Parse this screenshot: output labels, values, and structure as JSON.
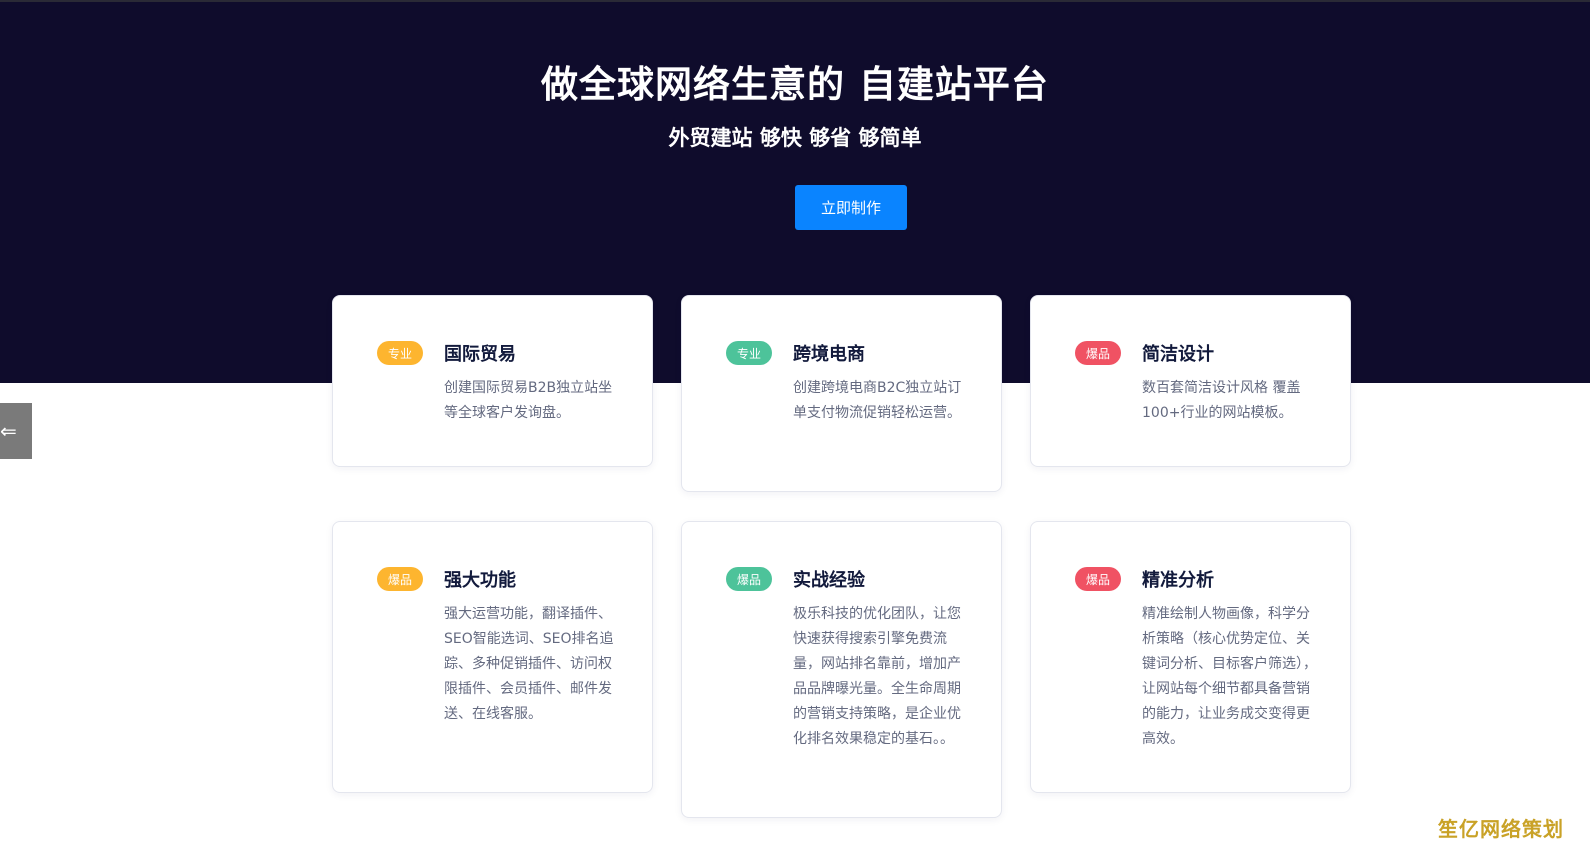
{
  "hero": {
    "title": "做全球网络生意的 自建站平台",
    "subtitle": "外贸建站 够快 够省 够简单",
    "cta_label": "立即制作"
  },
  "side_tab": {
    "icon": "arrow-left-icon",
    "glyph": "⇐"
  },
  "colors": {
    "hero_bg": "#0f0c2c",
    "cta": "#0a84ff",
    "badge_yellow": "#fdb52f",
    "badge_green": "#4dc39a",
    "badge_red": "#f05263"
  },
  "cards": [
    {
      "badge": "专业",
      "badge_color": "yellow",
      "title": "国际贸易",
      "desc": "创建国际贸易B2B独立站坐等全球客户发询盘。"
    },
    {
      "badge": "专业",
      "badge_color": "green",
      "title": "跨境电商",
      "desc": "创建跨境电商B2C独立站订单支付物流促销轻松运营。"
    },
    {
      "badge": "爆品",
      "badge_color": "red",
      "title": "简洁设计",
      "desc": "数百套简洁设计风格 覆盖100+行业的网站模板。"
    },
    {
      "badge": "爆品",
      "badge_color": "yellow",
      "title": "强大功能",
      "desc": "强大运营功能，翻译插件、SEO智能选词、SEO排名追踪、多种促销插件、访问权限插件、会员插件、邮件发送、在线客服。"
    },
    {
      "badge": "爆品",
      "badge_color": "green",
      "title": "实战经验",
      "desc": "极乐科技的优化团队，让您快速获得搜索引擎免费流量，网站排名靠前，增加产品品牌曝光量。全生命周期的营销支持策略，是企业优化排名效果稳定的基石。。"
    },
    {
      "badge": "爆品",
      "badge_color": "red",
      "title": "精准分析",
      "desc": "精准绘制人物画像，科学分析策略（核心优势定位、关键词分析、目标客户筛选），让网站每个细节都具备营销的能力，让业务成交变得更高效。"
    }
  ],
  "watermark": "笙亿网络策划"
}
